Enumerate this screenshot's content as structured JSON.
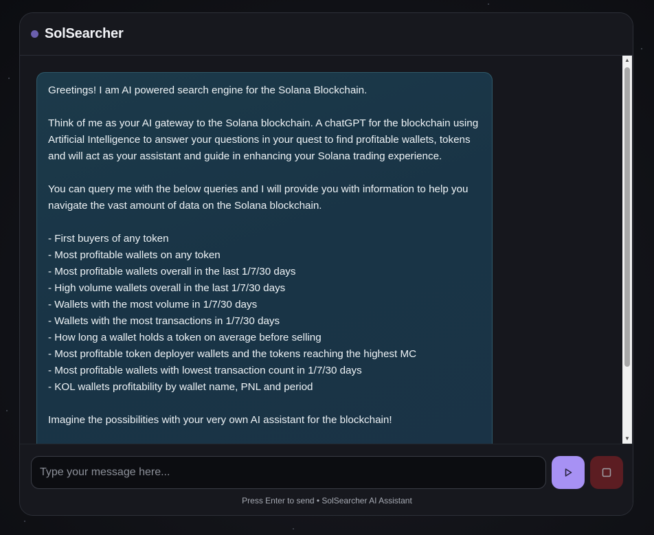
{
  "header": {
    "title": "SolSearcher"
  },
  "message": {
    "greeting": "Greetings! I am AI powered search engine for the Solana Blockchain.",
    "intro": "Think of me as your AI gateway to the Solana blockchain. A chatGPT for the blockchain using Artificial Intelligence to answer your questions in your quest to find profitable wallets, tokens and will act as your assistant and guide in enhancing your Solana trading experience.",
    "query_intro": "You can query me with the below queries and I will provide you with information to help you navigate the vast amount of data on the Solana blockchain.",
    "queries": [
      "- First buyers of any token",
      "- Most profitable wallets on any token",
      "- Most profitable wallets overall in the last 1/7/30 days",
      "- High volume wallets overall in the last 1/7/30 days",
      "- Wallets with the most volume in 1/7/30 days",
      "- Wallets with the most transactions in 1/7/30 days",
      "- How long a wallet holds a token on average before selling",
      "- Most profitable token deployer wallets and the tokens reaching the highest MC",
      "- Most profitable wallets with lowest transaction count in 1/7/30 days",
      "- KOL wallets profitability by wallet name, PNL and period"
    ],
    "closing": "Imagine the possibilities with your very own AI assistant for the blockchain!"
  },
  "input": {
    "placeholder": "Type your message here...",
    "value": ""
  },
  "footer": {
    "hint": "Press Enter to send • SolSearcher AI Assistant"
  },
  "icons": {
    "send": "play-icon",
    "stop": "stop-square-icon"
  },
  "colors": {
    "accent": "#a791f4",
    "stop": "#5c1d22",
    "bubble_border": "#2f5a6a",
    "status_dot": "#6b5fae"
  }
}
